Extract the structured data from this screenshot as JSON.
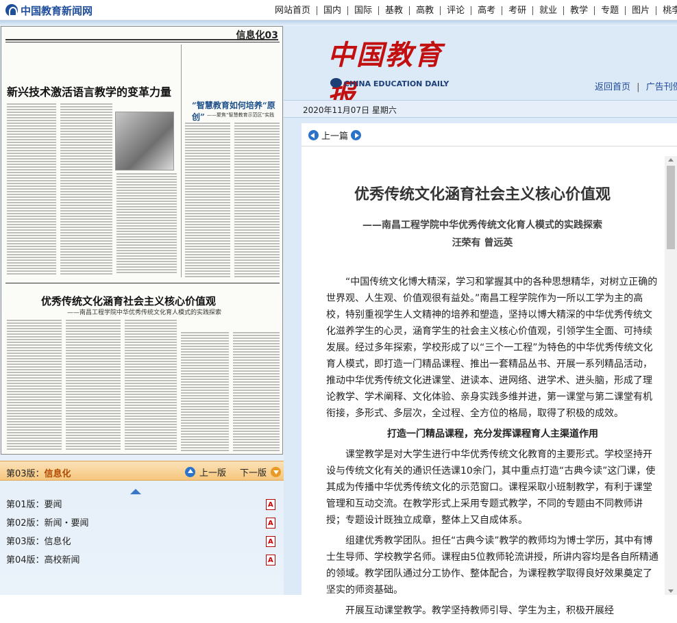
{
  "site": {
    "name": "中国教育新闻网"
  },
  "nav": [
    "网站首页",
    "国内",
    "国际",
    "基教",
    "高教",
    "评论",
    "高考",
    "考研",
    "就业",
    "教学",
    "专题",
    "图片",
    "桃李"
  ],
  "masthead": {
    "cn": "中国教育报",
    "en": "CHINA EDUCATION DAILY"
  },
  "toplinks": {
    "home": "返回首页",
    "separator": "|",
    "ads": "广告刊例"
  },
  "date": "2020年11月07日  星期六",
  "prev_article": "上一篇",
  "newspaper_page": {
    "page_label": "信息化03",
    "headline_top": "新兴技术激活语言教学的变革力量",
    "headline_right": "“智慧教育如何培养“原创”",
    "headline_right_sub": "——聚焦“智慧教育示范区”实践",
    "headline_main": "优秀传统文化涵育社会主义核心价值观",
    "headline_main_sub": "——南昌工程学院中华优秀传统文化育人模式的实践探索"
  },
  "pagebar": {
    "current_prefix": "第03版：",
    "current_name": "信息化",
    "prev": "上一版",
    "next": "下一版"
  },
  "page_list": [
    {
      "label": "第01版：要闻"
    },
    {
      "label": "第02版：新闻・要闻"
    },
    {
      "label": "第03版：信息化"
    },
    {
      "label": "第04版：高校新闻"
    }
  ],
  "article": {
    "title": "优秀传统文化涵育社会主义核心价值观",
    "subtitle": "——南昌工程学院中华优秀传统文化育人模式的实践探索",
    "author": "汪荣有  曾远英",
    "paragraphs": [
      "“中国传统文化博大精深，学习和掌握其中的各种思想精华，对树立正确的世界观、人生观、价值观很有益处。”南昌工程学院作为一所以工学为主的高校，特别重视学生人文精神的培养和塑造，坚持以博大精深的中华优秀传统文化滋养学生的心灵，涵育学生的社会主义核心价值观，引领学生全面、可持续发展。经过多年探索，学校形成了以“三个一工程”为特色的中华优秀传统文化育人模式，即打造一门精品课程、推出一套精品丛书、开展一系列精品活动，推动中华优秀传统文化进课堂、进读本、进网络、进学术、进头脑，形成了理论教学、学术阐释、文化体验、亲身实践多维并进，第一课堂与第二课堂有机衔接，多形式、多层次，全过程、全方位的格局，取得了积极的成效。",
      "课堂教学是对大学生进行中华优秀传统文化教育的主要形式。学校坚持开设与传统文化有关的通识任选课10余门，其中重点打造“古典今读”这门课，使其成为传播中华优秀传统文化的示范窗口。课程采取小班制教学，有利于课堂管理和互动交流。在教学形式上采用专题式教学，不同的专题由不同教师讲授；专题设计既独立成章，整体上又自成体系。",
      "组建优秀教学团队。担任“古典今读”教学的教师均为博士学历，其中有博士生导师、学校教学名师。课程由5位教师轮流讲授，所讲内容均是各自所精通的领域。教学团队通过分工协作、整体配合，为课程教学取得良好效果奠定了坚实的师资基础。",
      "开展互动课堂教学。教学坚持教师引导、学生为主，积极开展经"
    ],
    "section_heading": "打造一门精品课程，充分发挥课程育人主渠道作用"
  }
}
